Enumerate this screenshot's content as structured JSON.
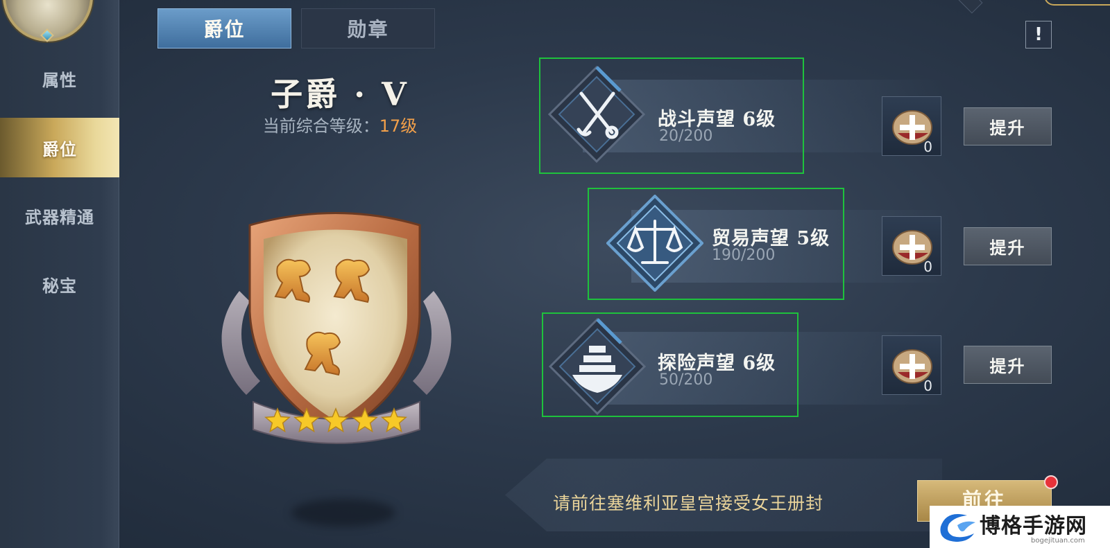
{
  "sidebar": {
    "items": [
      {
        "label": "属性",
        "active": false
      },
      {
        "label": "爵位",
        "active": true
      },
      {
        "label": "武器精通",
        "active": false
      },
      {
        "label": "秘宝",
        "active": false
      }
    ]
  },
  "tabs": [
    {
      "label": "爵位",
      "active": true
    },
    {
      "label": "勋章",
      "active": false
    }
  ],
  "help_label": "!",
  "rank": {
    "title": "子爵 · V",
    "level_caption": "当前综合等级：",
    "level_value": "17级",
    "stars": 5,
    "star_max": 5
  },
  "reputations": [
    {
      "name": "战斗声望 6级",
      "progress": "20/200",
      "current": 20,
      "max": 200,
      "icon": "crossed-swords-icon",
      "item_count": "0",
      "button": "提升"
    },
    {
      "name": "贸易声望 5级",
      "progress": "190/200",
      "current": 190,
      "max": 200,
      "icon": "scales-icon",
      "item_count": "0",
      "button": "提升"
    },
    {
      "name": "探险声望 6级",
      "progress": "50/200",
      "current": 50,
      "max": 200,
      "icon": "ship-icon",
      "item_count": "0",
      "button": "提升"
    }
  ],
  "quest": {
    "text": "请前往塞维利亚皇宫接受女王册封",
    "button": "前往"
  },
  "watermark": {
    "text": "博格手游网",
    "url": "bogejituan.com"
  },
  "colors": {
    "accent_gold": "#c9a85a",
    "tab_active": "#3f6e9d",
    "level_orange": "#f2a04a",
    "frame_green": "#1ec23c",
    "notification_red": "#e8323a"
  }
}
